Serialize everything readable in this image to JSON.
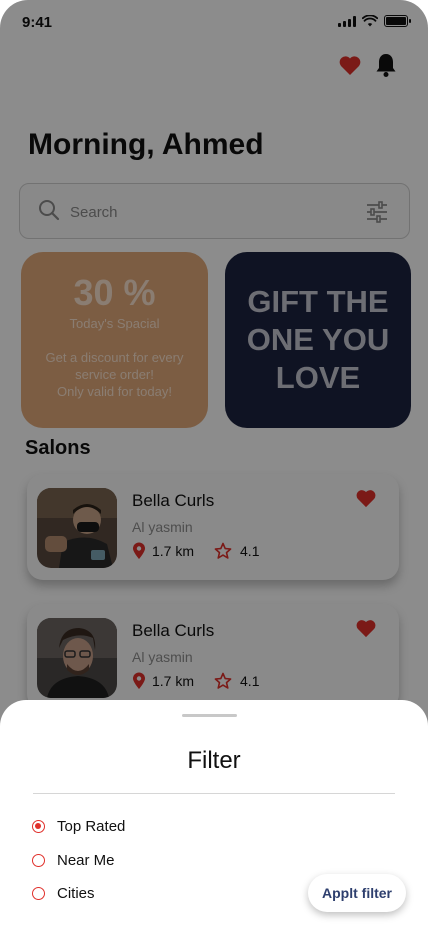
{
  "status_bar": {
    "time": "9:41"
  },
  "header": {
    "greeting": "Morning, Ahmed"
  },
  "search": {
    "placeholder": "Search"
  },
  "promo": {
    "percent": "30 %",
    "subtitle": "Today's Spacial",
    "description_line1": "Get a discount for every",
    "description_line2": "service order!",
    "description_line3": "Only valid for today!"
  },
  "gift": {
    "text": "GIFT THE ONE YOU LOVE"
  },
  "salons": {
    "title": "Salons",
    "items": [
      {
        "name": "Bella Curls",
        "area": "Al yasmin",
        "distance": "1.7 km",
        "rating": "4.1"
      },
      {
        "name": "Bella Curls",
        "area": "Al yasmin",
        "distance": "1.7 km",
        "rating": "4.1"
      }
    ]
  },
  "filter_sheet": {
    "title": "Filter",
    "options": [
      {
        "label": "Top Rated",
        "selected": true
      },
      {
        "label": "Near Me",
        "selected": false
      },
      {
        "label": "Cities",
        "selected": false
      }
    ],
    "apply_label": "Applt filter"
  },
  "colors": {
    "accent_red": "#e0302b",
    "promo_orange": "#e2a97a",
    "gift_navy": "#1d2340",
    "button_text": "#2e3f6e"
  },
  "icons": [
    "heart-icon",
    "bell-icon",
    "search-icon",
    "filter-sliders-icon",
    "location-pin-icon",
    "star-icon"
  ]
}
